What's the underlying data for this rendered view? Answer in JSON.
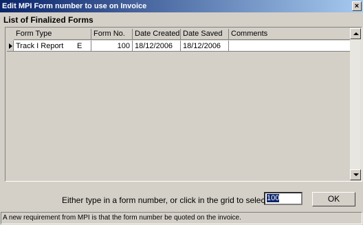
{
  "window": {
    "title": "Edit MPI Form number to use on Invoice",
    "close_glyph": "×"
  },
  "section_label": "List of Finalized Forms",
  "grid": {
    "columns": [
      "Form Type",
      "Form No.",
      "Date Created",
      "Date Saved",
      "Comments"
    ],
    "rows": [
      {
        "form_type": "Track I Report",
        "type_code": "E",
        "form_no": "100",
        "date_created": "18/12/2006",
        "date_saved": "18/12/2006",
        "comments": ""
      }
    ]
  },
  "prompt": "Either type in a form number, or click in the grid to select one.",
  "form_number_input": {
    "value": "100"
  },
  "ok_label": "OK",
  "status_text": "A new requirement from MPI is that the form number be quoted on the invoice."
}
